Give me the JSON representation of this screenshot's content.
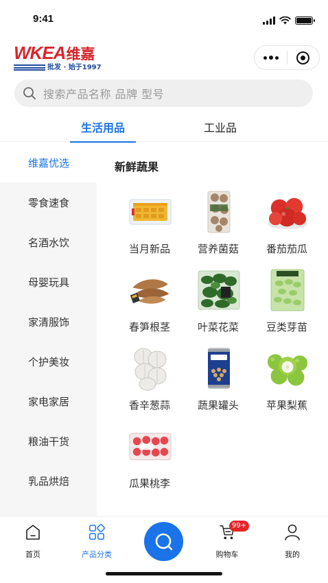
{
  "status_bar": {
    "time": "9:41",
    "icons": [
      "signal-icon",
      "wifi-icon",
      "battery-icon"
    ]
  },
  "header": {
    "logo": {
      "brand_en": "WKEA",
      "brand_cn": "维嘉",
      "tagline": "批发 · 始于1997"
    },
    "capsule": {
      "more_icon": "more-dots-icon",
      "close_icon": "target-icon"
    }
  },
  "search": {
    "placeholder": "搜索产品名称 品牌 型号",
    "icon": "search-icon"
  },
  "top_tabs": [
    {
      "label": "生活用品",
      "active": true
    },
    {
      "label": "工业品",
      "active": false
    }
  ],
  "sidebar": {
    "items": [
      {
        "label": "维嘉优选",
        "active": true
      },
      {
        "label": "零食速食",
        "active": false
      },
      {
        "label": "名酒水饮",
        "active": false
      },
      {
        "label": "母婴玩具",
        "active": false
      },
      {
        "label": "家清服饰",
        "active": false
      },
      {
        "label": "个护美妆",
        "active": false
      },
      {
        "label": "家电家居",
        "active": false
      },
      {
        "label": "粮油干货",
        "active": false
      },
      {
        "label": "乳品烘焙",
        "active": false
      }
    ]
  },
  "main": {
    "section_title": "新鲜蔬果",
    "products": [
      {
        "name": "当月新品",
        "image": "packaged-fruit-tray"
      },
      {
        "name": "营养菌菇",
        "image": "mushroom-pack"
      },
      {
        "name": "番茄茄瓜",
        "image": "tomatoes"
      },
      {
        "name": "春笋根茎",
        "image": "yams-roots"
      },
      {
        "name": "叶菜花菜",
        "image": "leafy-greens-bag"
      },
      {
        "name": "豆类芽苗",
        "image": "beans-bag"
      },
      {
        "name": "香辛葱蒜",
        "image": "garlic"
      },
      {
        "name": "蔬果罐头",
        "image": "canned-beans"
      },
      {
        "name": "苹果梨蕉",
        "image": "green-apples"
      },
      {
        "name": "瓜果桃李",
        "image": "strawberry-tray"
      }
    ]
  },
  "bottom_nav": {
    "items": [
      {
        "label": "首页",
        "icon": "home-icon",
        "active": false
      },
      {
        "label": "产品分类",
        "icon": "category-icon",
        "active": true
      },
      {
        "label": "",
        "icon": "scan-search-icon",
        "active": false
      },
      {
        "label": "购物车",
        "icon": "cart-icon",
        "active": false,
        "badge": "99+"
      },
      {
        "label": "我的",
        "icon": "user-icon",
        "active": false
      }
    ]
  },
  "colors": {
    "accent": "#1a73e8",
    "brand_red": "#d8262c",
    "brand_blue": "#1e4aa0",
    "badge_red": "#e5252a",
    "sidebar_bg": "#f6f6f6"
  }
}
